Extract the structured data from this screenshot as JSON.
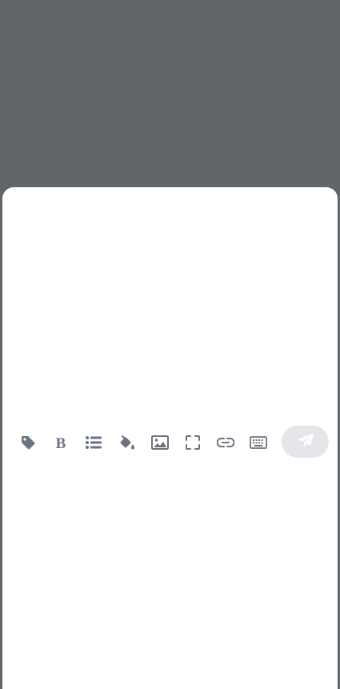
{
  "editor": {
    "placeholder": "",
    "value": ""
  },
  "toolbar": {
    "icons": [
      "tag-icon",
      "bold-icon",
      "list-icon",
      "color-fill-icon",
      "image-icon",
      "fullscreen-icon",
      "link-icon",
      "keyboard-icon"
    ],
    "send_icon": "paper-plane-icon"
  },
  "colors": {
    "backdrop": "#626668",
    "sheet": "#ffffff",
    "icon": "#6b7280",
    "send_bg": "#e4e6ea",
    "send_icon": "#ffffff"
  }
}
